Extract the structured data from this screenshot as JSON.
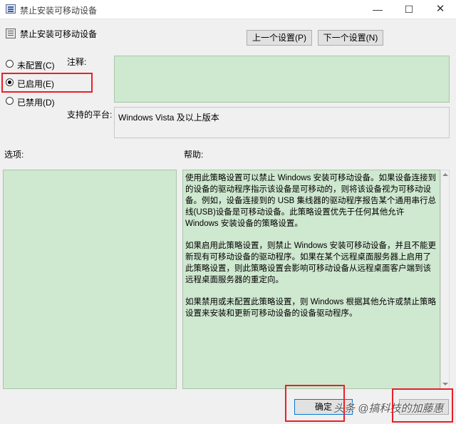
{
  "window": {
    "title": "禁止安装可移动设备",
    "minimize_glyph": "—",
    "maximize_glyph": "☐",
    "close_glyph": "✕"
  },
  "header": {
    "policy_name": "禁止安装可移动设备",
    "prev_button": "上一个设置(P)",
    "next_button": "下一个设置(N)"
  },
  "state": {
    "options": [
      {
        "label": "未配置(C)",
        "checked": false
      },
      {
        "label": "已启用(E)",
        "checked": true
      },
      {
        "label": "已禁用(D)",
        "checked": false
      }
    ]
  },
  "labels": {
    "comment": "注释:",
    "platform": "支持的平台:",
    "options": "选项:",
    "help": "帮助:"
  },
  "platform_value": "Windows Vista 及以上版本",
  "help_paragraphs": [
    "使用此策略设置可以禁止 Windows 安装可移动设备。如果设备连接到的设备的驱动程序指示该设备是可移动的，则将该设备视为可移动设备。例如，设备连接到的 USB 集线器的驱动程序报告某个通用串行总线(USB)设备是可移动设备。此策略设置优先于任何其他允许 Windows 安装设备的策略设置。",
    "如果启用此策略设置，则禁止 Windows 安装可移动设备，并且不能更新现有可移动设备的驱动程序。如果在某个远程桌面服务器上启用了此策略设置，则此策略设置会影响可移动设备从远程桌面客户端到该远程桌面服务器的重定向。",
    "如果禁用或未配置此策略设置，则 Windows 根据其他允许或禁止策略设置来安装和更新可移动设备的设备驱动程序。"
  ],
  "footer": {
    "ok_button": "确定",
    "watermark": "头条 @搞科技的加藤惠"
  },
  "colors": {
    "pane_bg": "#cfe8d0",
    "highlight": "#e8202a"
  }
}
